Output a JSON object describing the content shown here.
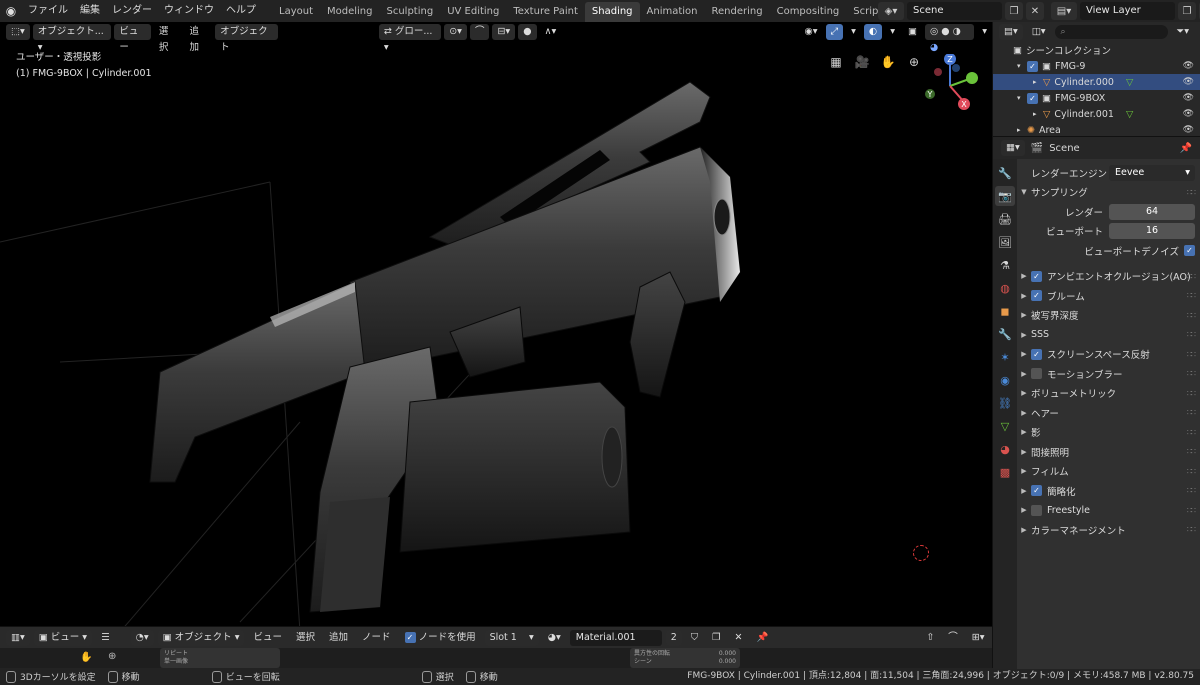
{
  "menu": [
    "ファイル",
    "編集",
    "レンダー",
    "ウィンドウ",
    "ヘルプ"
  ],
  "tabs": [
    {
      "label": "Layout",
      "active": false
    },
    {
      "label": "Modeling",
      "active": false
    },
    {
      "label": "Sculpting",
      "active": false
    },
    {
      "label": "UV Editing",
      "active": false
    },
    {
      "label": "Texture Paint",
      "active": false
    },
    {
      "label": "Shading",
      "active": true
    },
    {
      "label": "Animation",
      "active": false
    },
    {
      "label": "Rendering",
      "active": false
    },
    {
      "label": "Compositing",
      "active": false
    },
    {
      "label": "Scripting",
      "active": false
    }
  ],
  "scene": {
    "name": "Scene",
    "view_layer": "View Layer"
  },
  "viewport": {
    "mode": "オブジェクト...",
    "menus": [
      "ビュー",
      "選択",
      "追加",
      "オブジェクト"
    ],
    "transform_orientation": "グロー...",
    "projection_label": "ユーザー・透視投影",
    "object_label": "(1) FMG-9BOX | Cylinder.001",
    "gizmo_axes": {
      "z": "Z",
      "y": "Y",
      "x": "X"
    }
  },
  "node_editor": {
    "view_label": "ビュー",
    "mode": "オブジェクト",
    "menus": [
      "ビュー",
      "選択",
      "追加",
      "ノード"
    ],
    "use_nodes_label": "ノードを使用",
    "slot": "Slot 1",
    "material": "Material.001",
    "user_count": "2",
    "node_labels": [
      "リピート",
      "単一画像",
      "異方性の回転",
      "シーン"
    ],
    "node_values": [
      "0.000",
      "0.000"
    ]
  },
  "statusbar": {
    "items": [
      "3Dカーソルを設定",
      "移動",
      "ビューを回転",
      "選択",
      "移動"
    ],
    "info": "FMG-9BOX | Cylinder.001 | 頂点:12,804 | 面:11,504 | 三角面:24,996 | オブジェクト:0/9 | メモリ:458.7 MB | v2.80.75"
  },
  "outliner": {
    "root": "シーンコレクション",
    "rows": [
      {
        "label": "FMG-9",
        "type": "collection",
        "indent": 1,
        "selected": false
      },
      {
        "label": "Cylinder.000",
        "type": "mesh",
        "indent": 2,
        "selected": true
      },
      {
        "label": "FMG-9BOX",
        "type": "collection",
        "indent": 1,
        "selected": false
      },
      {
        "label": "Cylinder.001",
        "type": "mesh",
        "indent": 2,
        "selected": false
      },
      {
        "label": "Area",
        "type": "light",
        "indent": 1,
        "selected": false
      }
    ]
  },
  "properties": {
    "header": "Scene",
    "render_engine_label": "レンダーエンジン",
    "render_engine": "Eevee",
    "sampling_title": "サンプリング",
    "render_label": "レンダー",
    "render_value": "64",
    "viewport_label": "ビューポート",
    "viewport_value": "16",
    "denoise_label": "ビューポートデノイズ",
    "panels": [
      {
        "label": "アンビエントオクルージョン(AO)",
        "checkbox": true,
        "checked": true
      },
      {
        "label": "ブルーム",
        "checkbox": true,
        "checked": true
      },
      {
        "label": "被写界深度",
        "checkbox": false,
        "checked": false
      },
      {
        "label": "SSS",
        "checkbox": false,
        "checked": false
      },
      {
        "label": "スクリーンスペース反射",
        "checkbox": true,
        "checked": true
      },
      {
        "label": "モーションブラー",
        "checkbox": true,
        "checked": false
      },
      {
        "label": "ボリューメトリック",
        "checkbox": false,
        "checked": false
      },
      {
        "label": "ヘアー",
        "checkbox": false,
        "checked": false
      },
      {
        "label": "影",
        "checkbox": false,
        "checked": false
      },
      {
        "label": "間接照明",
        "checkbox": false,
        "checked": false
      },
      {
        "label": "フィルム",
        "checkbox": false,
        "checked": false
      },
      {
        "label": "簡略化",
        "checkbox": true,
        "checked": true
      },
      {
        "label": "Freestyle",
        "checkbox": true,
        "checked": false
      },
      {
        "label": "カラーマネージメント",
        "checkbox": false,
        "checked": false
      }
    ]
  },
  "colors": {
    "accent": "#4772b3",
    "selected_row": "#334d80",
    "active_tab": "#3a3a3a"
  }
}
